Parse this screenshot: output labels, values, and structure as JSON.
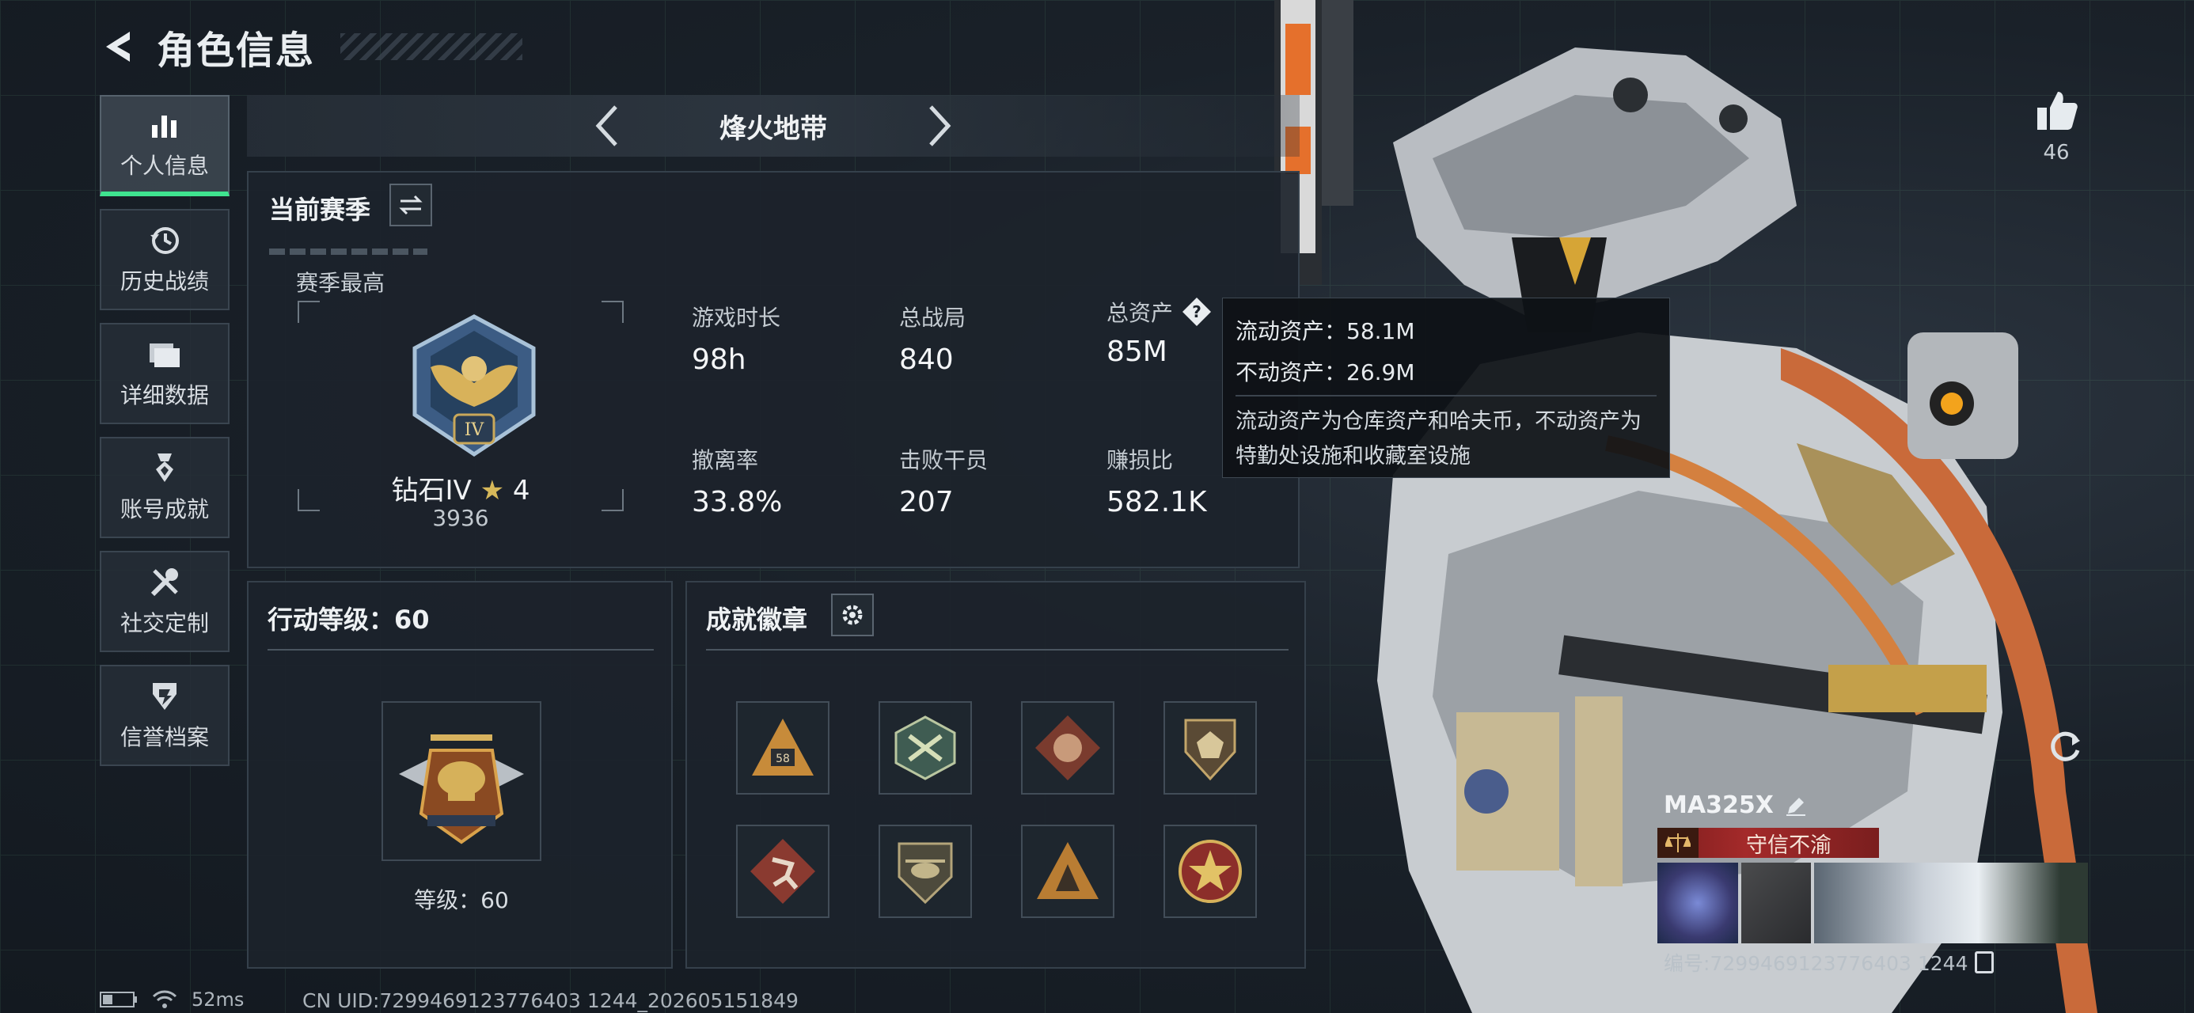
{
  "header": {
    "title": "角色信息"
  },
  "sidebar": {
    "items": [
      {
        "label": "个人信息",
        "icon": "bar-chart-icon",
        "active": true
      },
      {
        "label": "历史战绩",
        "icon": "history-clock-icon",
        "active": false
      },
      {
        "label": "详细数据",
        "icon": "folder-icon",
        "active": false
      },
      {
        "label": "账号成就",
        "icon": "achievement-medal-icon",
        "active": false
      },
      {
        "label": "社交定制",
        "icon": "tools-icon",
        "active": false
      },
      {
        "label": "信誉档案",
        "icon": "shield-icon",
        "active": false
      }
    ]
  },
  "mode_selector": {
    "label": "烽火地带"
  },
  "season": {
    "title": "当前赛季",
    "season_high_label": "赛季最高",
    "rank": {
      "name": "钻石IV",
      "stars": "4",
      "score": "3936",
      "emblem_numeral": "IV"
    },
    "stats": [
      {
        "label": "游戏时长",
        "value": "98h"
      },
      {
        "label": "总战局",
        "value": "840"
      },
      {
        "label": "总资产",
        "value": "85M",
        "help": true
      },
      {
        "label": "撤离率",
        "value": "33.8%"
      },
      {
        "label": "击败干员",
        "value": "207"
      },
      {
        "label": "赚损比",
        "value": "582.1K"
      }
    ]
  },
  "tooltip": {
    "liquid": "流动资产：58.1M",
    "fixed": "不动资产：26.9M",
    "description": "流动资产为仓库资产和哈夫币，不动资产为特勤处设施和收藏室设施"
  },
  "action_level": {
    "title": "行动等级：60",
    "level_label": "等级：60"
  },
  "badges": {
    "title": "成就徽章",
    "items": [
      {
        "name": "triangle-58-badge",
        "text": "58"
      },
      {
        "name": "dragonfly-hex-badge"
      },
      {
        "name": "dragon-diamond-badge"
      },
      {
        "name": "dice-shield-badge"
      },
      {
        "name": "runner-diamond-badge"
      },
      {
        "name": "helicopter-shield-badge"
      },
      {
        "name": "beast-triangle-badge"
      },
      {
        "name": "star-circle-badge"
      }
    ]
  },
  "social": {
    "likes": "46"
  },
  "player": {
    "name": "MA325X",
    "title": "守信不渝",
    "id_label": "编号:7299469123776403 1244"
  },
  "status": {
    "ping": "52ms",
    "uid": "CN UID:7299469123776403 1244_202605151849"
  },
  "colors": {
    "accent_green": "#3fe38f",
    "tooltip_bg": "#0e1115",
    "title_red": "#a42a2a"
  }
}
